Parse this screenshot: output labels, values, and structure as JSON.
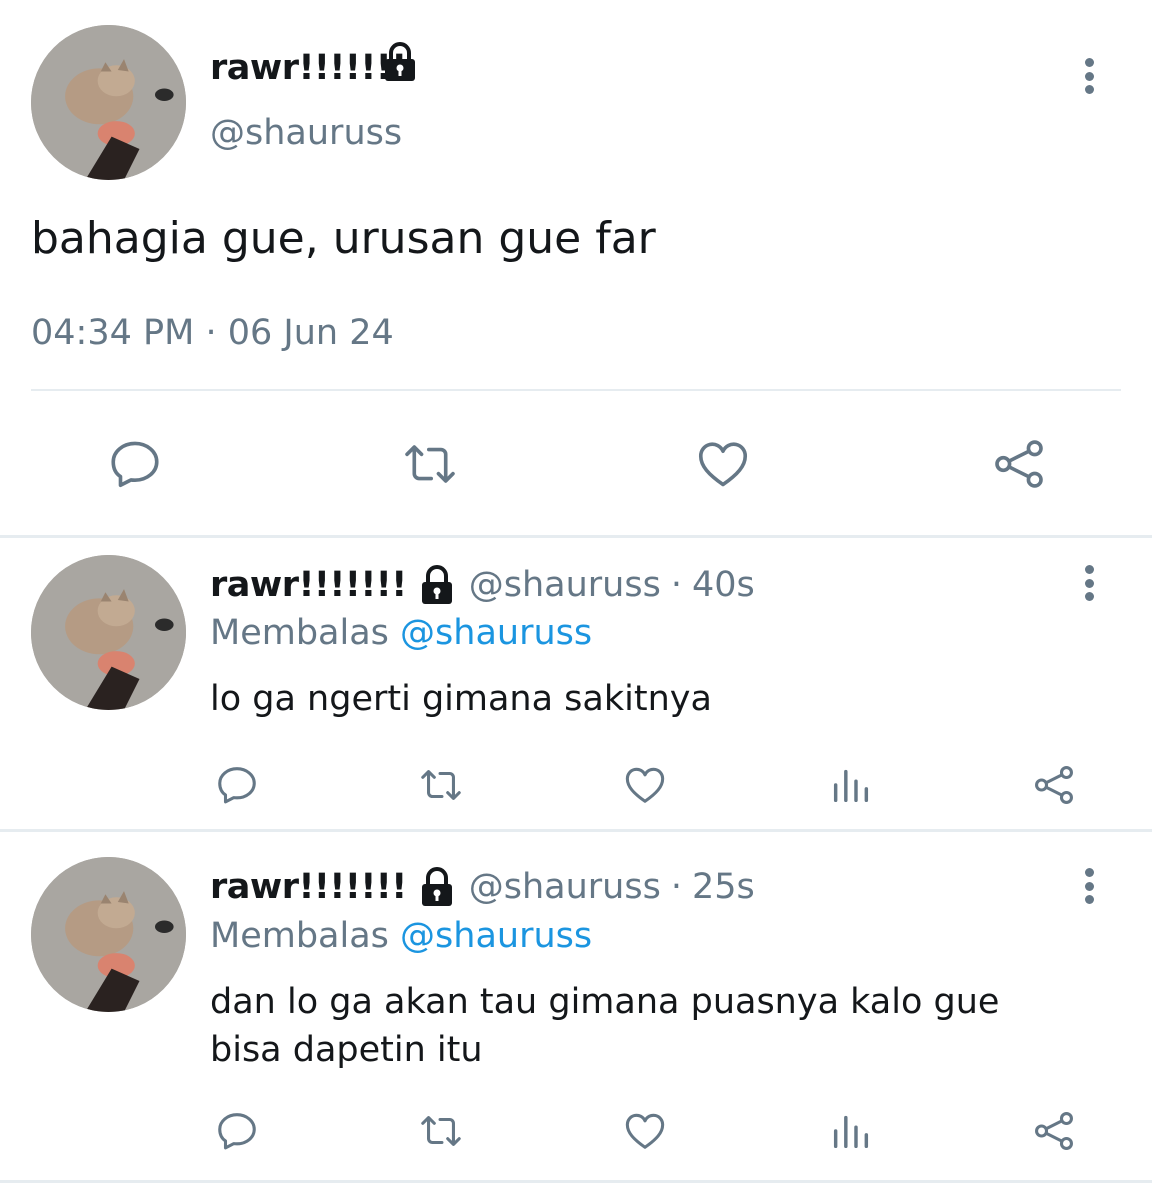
{
  "main_tweet": {
    "display_name": "rawr!!!!!!!",
    "handle": "@shauruss",
    "text": "bahagia gue, urusan gue far",
    "time": "04:34 PM",
    "separator": "·",
    "date": "06 Jun 24",
    "protected_icon": "lock-icon",
    "avatar_icon": "cat-avatar"
  },
  "replies": [
    {
      "display_name": "rawr!!!!!!!",
      "handle": "@shauruss",
      "separator": "·",
      "age": "40s",
      "replying_prefix": "Membalas",
      "replying_to": "@shauruss",
      "text": "lo ga ngerti gimana sakitnya"
    },
    {
      "display_name": "rawr!!!!!!!",
      "handle": "@shauruss",
      "separator": "·",
      "age": "25s",
      "replying_prefix": "Membalas",
      "replying_to": "@shauruss",
      "text_line1": "dan lo ga akan tau gimana puasnya kalo gue",
      "text_line2": "bisa dapetin itu"
    }
  ],
  "colors": {
    "text": "#14171a",
    "muted": "#657786",
    "link": "#1b95e0",
    "divider": "#e6ecf0"
  },
  "action_icons": [
    "reply-icon",
    "retweet-icon",
    "like-icon",
    "analytics-icon",
    "share-icon"
  ]
}
